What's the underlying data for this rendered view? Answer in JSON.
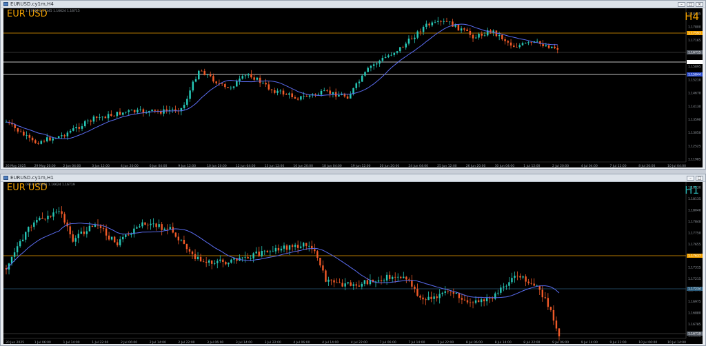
{
  "colors": {
    "bull": "#26c6b5",
    "bear": "#f05a28",
    "ma": "#5a6cf0",
    "orange_line": "#f0a000",
    "grid_text": "#9aa0a8",
    "h4_label": "#f0a000",
    "h1_label": "#2ab0b0"
  },
  "top_window": {
    "title": "EURUSD.cy1m,H4",
    "symbol": "EUR USD",
    "timeframe": "H4",
    "ohlc": "1.17064  1.17145  1.16624  1.16715",
    "price_labels": [
      "1.18435",
      "1.17800",
      "1.17165",
      "1.16530",
      "1.15895",
      "1.15210",
      "1.14670",
      "1.14130",
      "1.13590",
      "1.13050",
      "1.12525",
      "1.11985"
    ],
    "marker_labels": [
      {
        "text": "1.17593",
        "color": "#f0a000"
      },
      {
        "text": "1.16715",
        "color": "#555c66"
      },
      {
        "text": "1.16305",
        "color": "#ffffff"
      },
      {
        "text": "1.15844",
        "color": "#3050d0"
      }
    ],
    "time_labels": [
      "26 May 2025",
      "29 May 20:00",
      "2 Jun 04:00",
      "3 Jun 12:00",
      "4 Jun 20:00",
      "6 Jun 04:00",
      "9 Jun 12:00",
      "10 Jun 20:00",
      "12 Jun 04:00",
      "13 Jun 12:00",
      "16 Jun 20:00",
      "18 Jun 04:00",
      "19 Jun 12:00",
      "20 Jun 20:00",
      "24 Jun 04:00",
      "25 Jun 12:00",
      "26 Jun 20:00",
      "30 Jun 04:00",
      "1 Jul 12:00",
      "2 Jul 20:00",
      "4 Jul 04:00",
      "7 Jul 12:00",
      "8 Jul 20:00",
      "10 Jul 04:00"
    ]
  },
  "bottom_window": {
    "title": "EURUSD.cy1m,H1",
    "symbol": "EUR USD",
    "timeframe": "H1",
    "ohlc": "0924  1.16938  1.16624  1.16719",
    "price_labels": [
      "1.18330",
      "1.18135",
      "1.18040",
      "1.17840",
      "1.17750",
      "1.17655",
      "1.17460",
      "1.17315",
      "1.17215",
      "1.17070",
      "1.16975",
      "1.16880",
      "1.16785",
      "1.16690"
    ],
    "marker_labels": [
      {
        "text": "1.17637",
        "color": "#f0a000"
      },
      {
        "text": "1.17234",
        "color": "#2a5a7a"
      },
      {
        "text": "1.16719",
        "color": "#555c66"
      }
    ],
    "time_labels": [
      "30 Jun 2025",
      "1 Jul 06:00",
      "1 Jul 14:00",
      "1 Jul 22:00",
      "2 Jul 06:00",
      "2 Jul 14:00",
      "2 Jul 22:00",
      "3 Jul 06:00",
      "3 Jul 14:00",
      "3 Jul 22:00",
      "4 Jul 06:00",
      "4 Jul 14:00",
      "4 Jul 22:00",
      "7 Jul 06:00",
      "7 Jul 14:00",
      "7 Jul 22:00",
      "8 Jul 06:00",
      "8 Jul 14:00",
      "8 Jul 22:00",
      "9 Jul 06:00",
      "9 Jul 14:00",
      "9 Jul 22:00",
      "10 Jul 06:00",
      "10 Jul 14:00"
    ]
  }
}
